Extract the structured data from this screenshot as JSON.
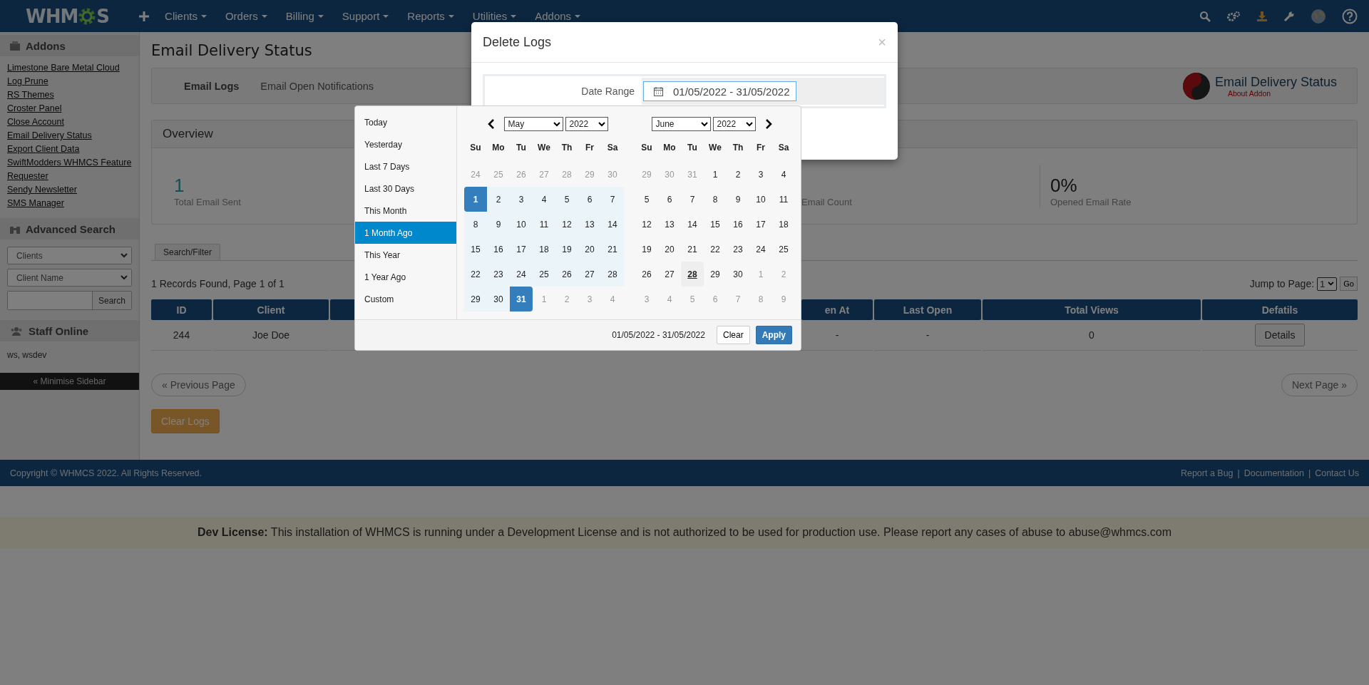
{
  "navbar": {
    "logo": {
      "left": "WHM",
      "right": "S"
    },
    "menu": [
      "Clients",
      "Orders",
      "Billing",
      "Support",
      "Reports",
      "Utilities",
      "Addons"
    ]
  },
  "sidebar": {
    "addons": {
      "title": "Addons",
      "links": [
        "Limestone Bare Metal Cloud",
        "Log Prune",
        "RS Themes",
        "Croster Panel",
        "Close Account",
        "Email Delivery Status",
        "Export Client Data",
        "SwiftModders WHMCS Feature Requester",
        "Sendy Newsletter",
        "SMS Manager"
      ]
    },
    "advanced_search": {
      "title": "Advanced Search",
      "selects": [
        "Clients",
        "Client Name"
      ],
      "button": "Search"
    },
    "staff_online": {
      "title": "Staff Online",
      "names": "ws, wsdev"
    },
    "minimise": "« Minimise Sidebar"
  },
  "page": {
    "title": "Email Delivery Status",
    "tabs": [
      {
        "label": "Email Logs",
        "selected": true
      },
      {
        "label": "Email Open Notifications",
        "selected": false
      }
    ],
    "brand": {
      "name": "Email Delivery Status",
      "link": "About Addon"
    },
    "overview": {
      "title": "Overview",
      "stats": [
        {
          "value": "1",
          "label": "Total Email Sent"
        },
        {
          "label": "Email Count"
        },
        {
          "value": "0%",
          "label": "Opened Email Rate"
        }
      ]
    },
    "filter_tab": "Search/Filter",
    "records": "1 Records Found, Page 1 of 1",
    "jump": {
      "label": "Jump to Page:",
      "value": "1",
      "button": "Go"
    },
    "table": {
      "columns": [
        "ID",
        "Client",
        "en At",
        "Last Open",
        "Total Views",
        "Defatils"
      ],
      "rows": [
        {
          "cells": [
            "244",
            "Joe Doe",
            "-",
            "-",
            "0"
          ],
          "action": "Details"
        }
      ]
    },
    "prev": "« Previous Page",
    "next": "Next Page »",
    "clear_logs": "Clear Logs"
  },
  "footer": {
    "copyright": "Copyright © WHMCS 2022. All Rights Reserved.",
    "links": [
      "Report a Bug",
      "Documentation",
      "Contact Us"
    ],
    "separator": "|"
  },
  "dev_license": "**Dev License:** This installation of WHMCS is running under a Development License and is not authorized to be used for production use. Please report any cases of abuse to abuse@whmcs.com",
  "modal": {
    "title": "Delete Logs",
    "close": "×",
    "label": "Date Range",
    "value": "01/05/2022 - 31/05/2022"
  },
  "datepicker": {
    "ranges": [
      {
        "label": "Today",
        "selected": false
      },
      {
        "label": "Yesterday",
        "selected": false
      },
      {
        "label": "Last 7 Days",
        "selected": false
      },
      {
        "label": "Last 30 Days",
        "selected": false
      },
      {
        "label": "This Month",
        "selected": false
      },
      {
        "label": "1 Month Ago",
        "selected": true
      },
      {
        "label": "This Year",
        "selected": false
      },
      {
        "label": "1 Year Ago",
        "selected": false
      },
      {
        "label": "Custom",
        "selected": false
      }
    ],
    "calendars": [
      {
        "month": "May",
        "year": "2022",
        "weekdays": [
          "Su",
          "Mo",
          "Tu",
          "We",
          "Th",
          "Fr",
          "Sa"
        ],
        "weeks": [
          [
            {
              "day": "24",
              "kind": "off"
            },
            {
              "day": "25",
              "kind": "off"
            },
            {
              "day": "26",
              "kind": "off"
            },
            {
              "day": "27",
              "kind": "off"
            },
            {
              "day": "28",
              "kind": "off"
            },
            {
              "day": "29",
              "kind": "off"
            },
            {
              "day": "30",
              "kind": "off"
            }
          ],
          [
            {
              "day": "1",
              "kind": "start"
            },
            {
              "day": "2",
              "kind": "in-range"
            },
            {
              "day": "3",
              "kind": "in-range"
            },
            {
              "day": "4",
              "kind": "in-range"
            },
            {
              "day": "5",
              "kind": "in-range"
            },
            {
              "day": "6",
              "kind": "in-range"
            },
            {
              "day": "7",
              "kind": "in-range"
            }
          ],
          [
            {
              "day": "8",
              "kind": "in-range"
            },
            {
              "day": "9",
              "kind": "in-range"
            },
            {
              "day": "10",
              "kind": "in-range"
            },
            {
              "day": "11",
              "kind": "in-range"
            },
            {
              "day": "12",
              "kind": "in-range"
            },
            {
              "day": "13",
              "kind": "in-range"
            },
            {
              "day": "14",
              "kind": "in-range"
            }
          ],
          [
            {
              "day": "15",
              "kind": "in-range"
            },
            {
              "day": "16",
              "kind": "in-range"
            },
            {
              "day": "17",
              "kind": "in-range"
            },
            {
              "day": "18",
              "kind": "in-range"
            },
            {
              "day": "19",
              "kind": "in-range"
            },
            {
              "day": "20",
              "kind": "in-range"
            },
            {
              "day": "21",
              "kind": "in-range"
            }
          ],
          [
            {
              "day": "22",
              "kind": "in-range"
            },
            {
              "day": "23",
              "kind": "in-range"
            },
            {
              "day": "24",
              "kind": "in-range"
            },
            {
              "day": "25",
              "kind": "in-range"
            },
            {
              "day": "26",
              "kind": "in-range"
            },
            {
              "day": "27",
              "kind": "in-range"
            },
            {
              "day": "28",
              "kind": "in-range"
            }
          ],
          [
            {
              "day": "29",
              "kind": "in-range"
            },
            {
              "day": "30",
              "kind": "in-range"
            },
            {
              "day": "31",
              "kind": "end"
            },
            {
              "day": "1",
              "kind": "off"
            },
            {
              "day": "2",
              "kind": "off"
            },
            {
              "day": "3",
              "kind": "off"
            },
            {
              "day": "4",
              "kind": "off"
            }
          ]
        ]
      },
      {
        "month": "June",
        "year": "2022",
        "weekdays": [
          "Su",
          "Mo",
          "Tu",
          "We",
          "Th",
          "Fr",
          "Sa"
        ],
        "weeks": [
          [
            {
              "day": "29",
              "kind": "off"
            },
            {
              "day": "30",
              "kind": "off"
            },
            {
              "day": "31",
              "kind": "off"
            },
            {
              "day": "1",
              "kind": "normal"
            },
            {
              "day": "2",
              "kind": "normal"
            },
            {
              "day": "3",
              "kind": "normal"
            },
            {
              "day": "4",
              "kind": "normal"
            }
          ],
          [
            {
              "day": "5",
              "kind": "normal"
            },
            {
              "day": "6",
              "kind": "normal"
            },
            {
              "day": "7",
              "kind": "normal"
            },
            {
              "day": "8",
              "kind": "normal"
            },
            {
              "day": "9",
              "kind": "normal"
            },
            {
              "day": "10",
              "kind": "normal"
            },
            {
              "day": "11",
              "kind": "normal"
            }
          ],
          [
            {
              "day": "12",
              "kind": "normal"
            },
            {
              "day": "13",
              "kind": "normal"
            },
            {
              "day": "14",
              "kind": "normal"
            },
            {
              "day": "15",
              "kind": "normal"
            },
            {
              "day": "16",
              "kind": "normal"
            },
            {
              "day": "17",
              "kind": "normal"
            },
            {
              "day": "18",
              "kind": "normal"
            }
          ],
          [
            {
              "day": "19",
              "kind": "normal"
            },
            {
              "day": "20",
              "kind": "normal"
            },
            {
              "day": "21",
              "kind": "normal"
            },
            {
              "day": "22",
              "kind": "normal"
            },
            {
              "day": "23",
              "kind": "normal"
            },
            {
              "day": "24",
              "kind": "normal"
            },
            {
              "day": "25",
              "kind": "normal"
            }
          ],
          [
            {
              "day": "26",
              "kind": "normal"
            },
            {
              "day": "27",
              "kind": "normal"
            },
            {
              "day": "28",
              "kind": "today"
            },
            {
              "day": "29",
              "kind": "normal"
            },
            {
              "day": "30",
              "kind": "normal"
            },
            {
              "day": "1",
              "kind": "off"
            },
            {
              "day": "2",
              "kind": "off"
            }
          ],
          [
            {
              "day": "3",
              "kind": "off"
            },
            {
              "day": "4",
              "kind": "off"
            },
            {
              "day": "5",
              "kind": "off"
            },
            {
              "day": "6",
              "kind": "off"
            },
            {
              "day": "7",
              "kind": "off"
            },
            {
              "day": "8",
              "kind": "off"
            },
            {
              "day": "9",
              "kind": "off"
            }
          ]
        ]
      }
    ],
    "selected_text": "01/05/2022 - 31/05/2022",
    "clear": "Clear",
    "apply": "Apply"
  }
}
